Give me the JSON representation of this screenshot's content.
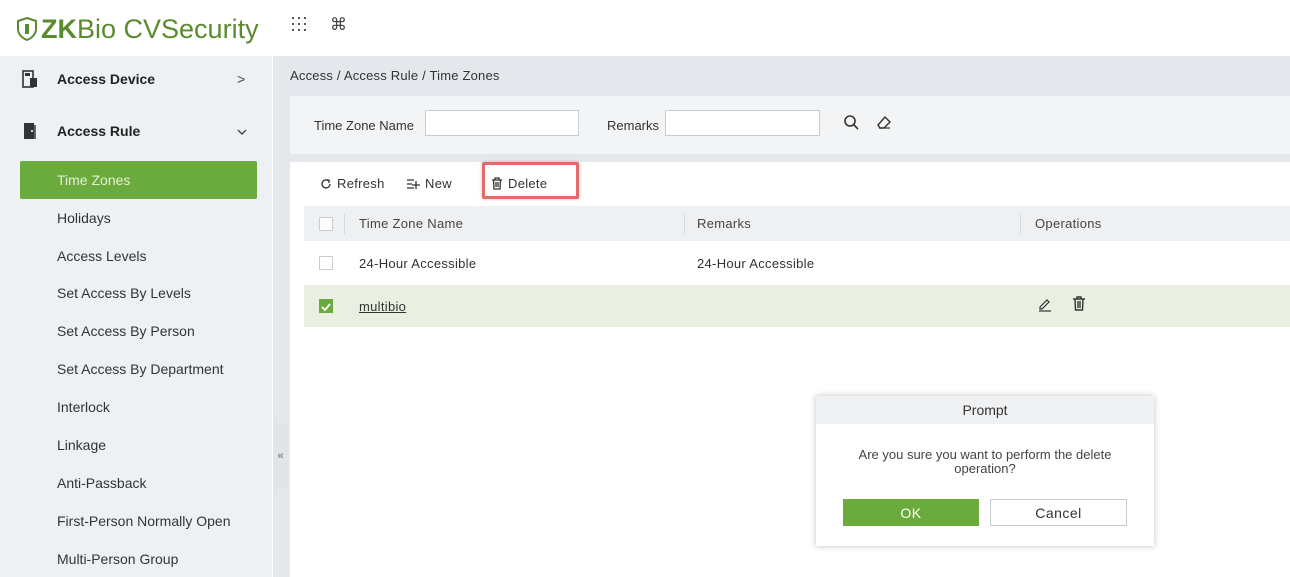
{
  "app": {
    "logo_brand": "ZK",
    "logo_rest": "Bio CVSecurity",
    "brand_color": "#5a8c2f",
    "accent_color": "#6bab3e",
    "top_icons": [
      "apps-grid-icon",
      "command-icon"
    ]
  },
  "sidebar": {
    "groups": [
      {
        "label": "Access Device",
        "icon": "device-icon",
        "arrow": ">"
      },
      {
        "label": "Access Rule",
        "icon": "door-icon",
        "arrow": "v"
      }
    ],
    "items": [
      {
        "label": "Time Zones",
        "active": true
      },
      {
        "label": "Holidays"
      },
      {
        "label": "Access Levels"
      },
      {
        "label": "Set Access By Levels"
      },
      {
        "label": "Set Access By Person"
      },
      {
        "label": "Set Access By Department"
      },
      {
        "label": "Interlock"
      },
      {
        "label": "Linkage"
      },
      {
        "label": "Anti-Passback"
      },
      {
        "label": "First-Person Normally Open"
      },
      {
        "label": "Multi-Person Group"
      }
    ],
    "collapse_glyph": "«"
  },
  "breadcrumb": "Access / Access Rule / Time Zones",
  "search": {
    "time_zone_label": "Time Zone Name",
    "time_zone_value": "",
    "remarks_label": "Remarks",
    "remarks_value": ""
  },
  "toolbar": {
    "refresh": "Refresh",
    "new": "New",
    "delete": "Delete"
  },
  "table": {
    "columns": [
      "Time Zone Name",
      "Remarks",
      "Operations"
    ],
    "rows": [
      {
        "name": "24-Hour Accessible",
        "remarks": "24-Hour Accessible",
        "checked": false
      },
      {
        "name": "multibio",
        "remarks": "",
        "checked": true
      }
    ]
  },
  "modal": {
    "title": "Prompt",
    "message": "Are you sure you want to perform the delete operation?",
    "ok": "OK",
    "cancel": "Cancel"
  }
}
